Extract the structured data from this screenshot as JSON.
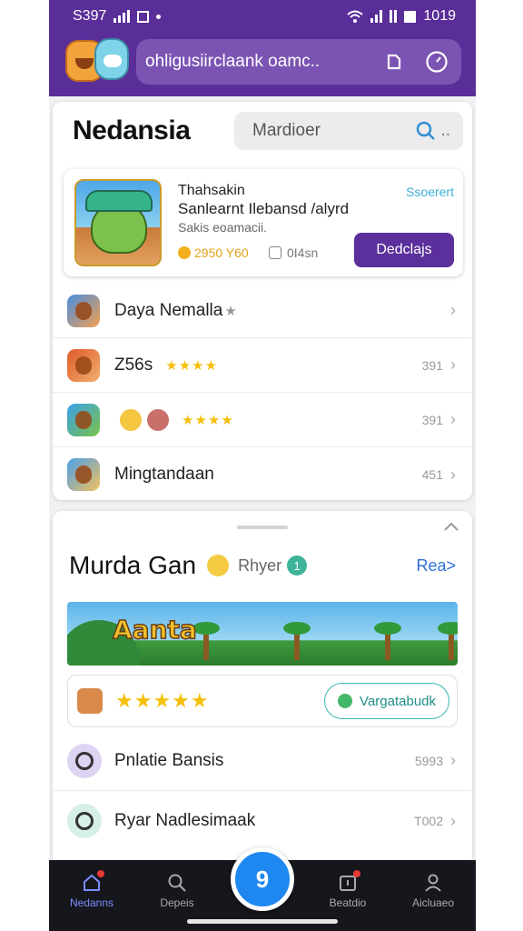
{
  "status": {
    "left_text": "S397",
    "right_text": "1019"
  },
  "header": {
    "url_text": "ohligusiirclaank oamc..",
    "refresh_icon": "refresh-icon",
    "timer_icon": "timer-icon"
  },
  "main": {
    "title": "Nedansia",
    "search_placeholder": "Mardioer",
    "search_suffix": "..",
    "featured": {
      "title": "Thahsakin",
      "subtitle": "Sanlearnt Ilebansd /alyrd",
      "meta": "Sakis eoamacii.",
      "price": "2950 Y60",
      "size": "0I4sn",
      "tag": "Ssoerert",
      "button": "Dedclajs"
    },
    "apps": [
      {
        "name": "Daya Nemalla",
        "stars": "★",
        "value": "",
        "colors": [
          "#4a8de0",
          "#f0a050"
        ]
      },
      {
        "name": "Z56s",
        "stars": "★★★★",
        "value": "391",
        "colors": [
          "#e05a2a",
          "#f0b070"
        ]
      },
      {
        "name": "",
        "stars": "★★★★",
        "value": "391",
        "colors": [
          "#3aa0e8",
          "#7ac34a"
        ]
      },
      {
        "name": "Mingtandaan",
        "stars": "",
        "value": "451",
        "colors": [
          "#4aa0e8",
          "#f2c060"
        ]
      }
    ]
  },
  "section": {
    "title": "Murda Gan",
    "subtitle": "Rhyer",
    "badge": "1",
    "see_all": "Rea>",
    "banner_title": "Aanta",
    "rating_stars": "★★★★★",
    "pill_label": "Vargatabudk",
    "items": [
      {
        "name": "Pnlatie Bansis",
        "value": "5993",
        "icon_bg": "#ddd3f2"
      },
      {
        "name": "Ryar Nadlesimaak",
        "value": "T002",
        "icon_bg": "#d6efe8"
      }
    ]
  },
  "tabbar": {
    "tabs": [
      {
        "label": "Nedanns",
        "icon": "home-icon"
      },
      {
        "label": "Depeis",
        "icon": "search-icon"
      },
      {
        "label": "Beatdio",
        "icon": "inbox-icon"
      },
      {
        "label": "Aicluaeo",
        "icon": "profile-icon"
      }
    ],
    "fab_label": "9"
  }
}
